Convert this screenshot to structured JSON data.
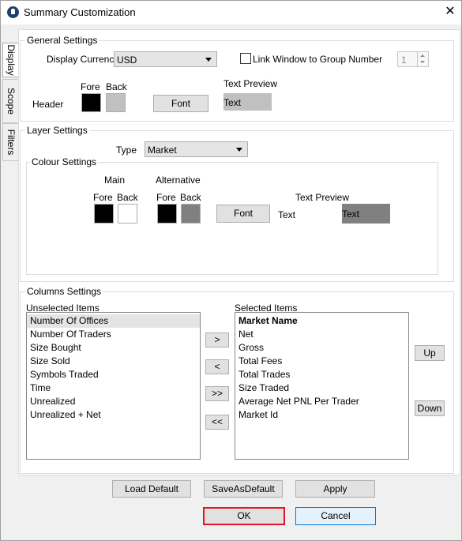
{
  "window": {
    "title": "Summary Customization",
    "close_label": "✕"
  },
  "tabs": [
    {
      "label": "Display",
      "active": true
    },
    {
      "label": "Scope",
      "active": false
    },
    {
      "label": "Filters",
      "active": false
    }
  ],
  "general_settings": {
    "label": "General Settings",
    "display_currency_label": "Display Currency",
    "display_currency_value": "USD",
    "link_window_label": "Link Window to Group Number",
    "link_window_checked": false,
    "group_number_value": "1",
    "fore_label": "Fore",
    "back_label": "Back",
    "header_label": "Header",
    "font_button": "Font",
    "text_preview_label": "Text Preview",
    "text_preview_text": "Text",
    "colors": {
      "fore": "#000000",
      "back": "#c0c0c0",
      "preview_bg": "#c0c0c0"
    }
  },
  "layer_settings": {
    "label": "Layer Settings",
    "type_label": "Type",
    "type_value": "Market",
    "colour_settings": {
      "label": "Colour Settings",
      "main_label": "Main",
      "alternative_label": "Alternative",
      "fore_label": "Fore",
      "back_label": "Back",
      "font_button": "Font",
      "text_label": "Text",
      "text_preview_label": "Text Preview",
      "text_preview_text": "Text",
      "colors": {
        "main_fore": "#000000",
        "main_back": "#ffffff",
        "alt_fore": "#000000",
        "alt_back": "#808080",
        "preview_bg": "#808080"
      }
    }
  },
  "columns_settings": {
    "label": "Columns Settings",
    "unselected_label": "Unselected Items",
    "selected_label": "Selected Items",
    "unselected_items": [
      "Number Of Offices",
      "Number Of Traders",
      "Size Bought",
      "Size Sold",
      "Symbols Traded",
      "Time",
      "Unrealized",
      "Unrealized + Net"
    ],
    "selected_items": [
      "Market Name",
      "Net",
      "Gross",
      "Total Fees",
      "Total Trades",
      "Size Traded",
      "Average Net PNL Per Trader",
      "Market Id"
    ],
    "move_right": ">",
    "move_left": "<",
    "move_all_right": ">>",
    "move_all_left": "<<",
    "up_button": "Up",
    "down_button": "Down"
  },
  "footer": {
    "load_default": "Load Default",
    "save_as_default": "SaveAsDefault",
    "apply": "Apply",
    "ok": "OK",
    "cancel": "Cancel",
    "ok_border_color": "#e81123",
    "cancel_border_color": "#0078d7"
  }
}
